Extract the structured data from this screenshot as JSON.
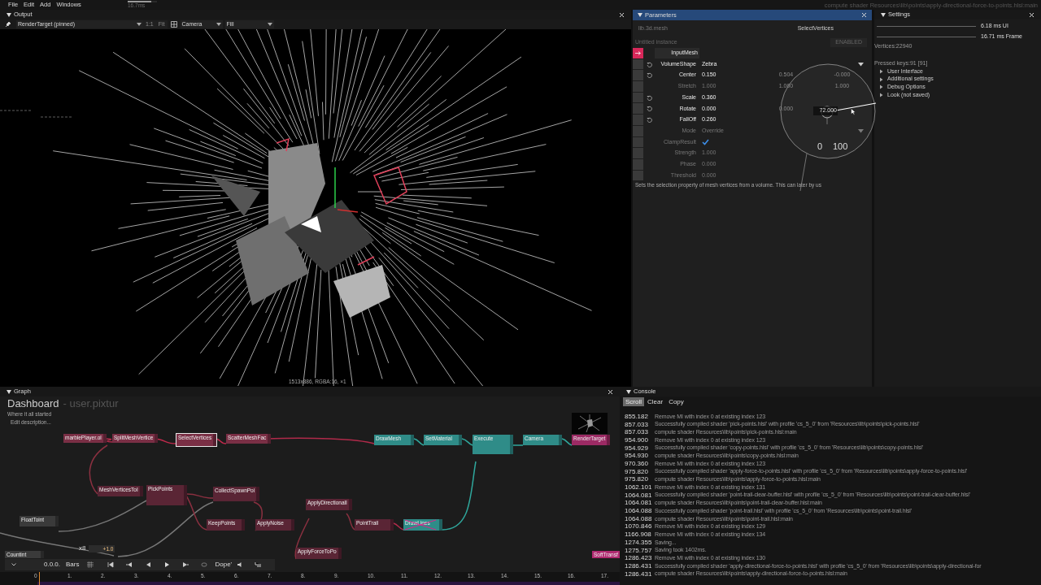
{
  "menu": [
    "File",
    "Edit",
    "Add",
    "Windows"
  ],
  "frame_meter": {
    "label": "16.7ms",
    "level": 0.8
  },
  "title_path": "compute shader Resources\\lib\\points\\apply-directional-force-to-points.hlsl:main",
  "output": {
    "title": "Output",
    "target": "RenderTarget (pinned)",
    "zoom_buttons": [
      "1:1",
      "Fit"
    ],
    "camera": "Camera",
    "fill": "Fill",
    "status": "1513x886, RGBA:16, ×1"
  },
  "parameters": {
    "title": "Parameters",
    "library": "lib.3d.mesh",
    "operator": "SelectVertices",
    "instance": "Untitled instance",
    "enabled_label": "ENABLED",
    "rows": [
      {
        "label": "InputMesh",
        "kind": "input",
        "modified": false
      },
      {
        "label": "VolumeShape",
        "kind": "dropdown",
        "value": "Zebra",
        "modified": true
      },
      {
        "label": "Center",
        "kind": "vector",
        "values": [
          "0.150",
          "0.504",
          "-0.000"
        ],
        "modified": true
      },
      {
        "label": "Stretch",
        "kind": "vector",
        "values": [
          "1.000",
          "1.000",
          "1.000"
        ],
        "modified": false
      },
      {
        "label": "Scale",
        "kind": "vector",
        "values": [
          "0.360"
        ],
        "modified": true
      },
      {
        "label": "Rotate",
        "kind": "vector",
        "values": [
          "0.000",
          "0.000"
        ],
        "modified": true
      },
      {
        "label": "FallOff",
        "kind": "vector",
        "values": [
          "0.260"
        ],
        "modified": true
      },
      {
        "label": "Mode",
        "kind": "dropdown",
        "value": "Override",
        "modified": false
      },
      {
        "label": "ClampResult",
        "kind": "checkbox",
        "checked": true,
        "modified": false
      },
      {
        "label": "Strength",
        "kind": "vector",
        "values": [
          "1.000"
        ],
        "modified": false
      },
      {
        "label": "Phase",
        "kind": "vector",
        "values": [
          "0.000"
        ],
        "modified": false
      },
      {
        "label": "Threshold",
        "kind": "vector",
        "values": [
          "0.000"
        ],
        "modified": false
      }
    ],
    "description": "Sets the selection property of mesh vertices from a volume. This can later by us",
    "dial": {
      "value": "72.000",
      "min": "0",
      "max": "100"
    }
  },
  "settings": {
    "title": "Settings",
    "meters": [
      "6.18 ms UI",
      "16.71 ms Frame"
    ],
    "vertices": "Vertices:22940",
    "pressed_keys": "Pressed keys:91 [91]",
    "items": [
      {
        "label": "User Interface",
        "expanded": false
      },
      {
        "label": "Additional settings",
        "expanded": false
      },
      {
        "label": "Debug Options",
        "expanded": false
      },
      {
        "label": "Look (not saved)",
        "expanded": false
      }
    ]
  },
  "graph": {
    "title": "Graph",
    "name": "Dashboard",
    "user": "- user.pixtur",
    "description": "Where it all started",
    "edit_link": "Edit description...",
    "nodes": [
      {
        "label": "marblePlayer.ol",
        "color": "#7a2f45",
        "selected": false,
        "bypassed": false
      },
      {
        "label": "SplitMeshVertice",
        "color": "#7a2f45",
        "selected": false,
        "bypassed": false
      },
      {
        "label": "SelectVertices",
        "color": "#7a2f45",
        "selected": true,
        "bypassed": false
      },
      {
        "label": "ScatterMeshFac",
        "color": "#7a2f45",
        "selected": false,
        "bypassed": false
      },
      {
        "label": "DrawMesh",
        "color": "#2f8c88",
        "selected": false,
        "bypassed": false
      },
      {
        "label": "SetMaterial",
        "color": "#2f8c88",
        "selected": false,
        "bypassed": false
      },
      {
        "label": "Execute",
        "color": "#2f8c88",
        "selected": false,
        "bypassed": false
      },
      {
        "label": "Camera",
        "color": "#2f8c88",
        "selected": false,
        "bypassed": false
      },
      {
        "label": "RenderTarget",
        "color": "#9c2a64",
        "selected": false,
        "bypassed": false
      },
      {
        "label": "MeshVerticesToI",
        "color": "#5a2535",
        "selected": false,
        "bypassed": false
      },
      {
        "label": "PickPoints",
        "color": "#5a2535",
        "selected": false,
        "bypassed": false
      },
      {
        "label": "CollectSpawnPoi",
        "color": "#5a2535",
        "selected": false,
        "bypassed": false
      },
      {
        "label": "KeepPoints",
        "color": "#5a2535",
        "selected": false,
        "bypassed": false
      },
      {
        "label": "ApplyNoise",
        "color": "#5a2535",
        "selected": false,
        "bypassed": false
      },
      {
        "label": "ApplyDirectionalI",
        "color": "#5a2535",
        "selected": false,
        "bypassed": false
      },
      {
        "label": "PointTrail",
        "color": "#5a2535",
        "selected": false,
        "bypassed": false
      },
      {
        "label": "DrawLines",
        "color": "#2f8c88",
        "selected": false,
        "bypassed": true
      },
      {
        "label": "ApplyForceToPo",
        "color": "#5a2535",
        "selected": false,
        "bypassed": false
      },
      {
        "label": "FloatToint",
        "color": "#3a3a3a",
        "selected": false,
        "bypassed": false
      },
      {
        "label": "Countint",
        "color": "#3a3a3a",
        "selected": false,
        "bypassed": false
      },
      {
        "label": "SoftTransf",
        "color": "#b02a70",
        "selected": false,
        "bypassed": false
      }
    ],
    "counter": {
      "label": "x8",
      "value": "+1.0"
    },
    "transport": {
      "time": "0.0.0.",
      "unit": "Bars",
      "mode": "Dope'"
    },
    "timeline_ticks": [
      "0",
      "1.",
      "2.",
      "3.",
      "4.",
      "5.",
      "6.",
      "7.",
      "8.",
      "9.",
      "10.",
      "11.",
      "12.",
      "13.",
      "14.",
      "15.",
      "16.",
      "17."
    ]
  },
  "console": {
    "title": "Console",
    "buttons": [
      {
        "label": "Scroll",
        "selected": true
      },
      {
        "label": "Clear",
        "selected": false
      },
      {
        "label": "Copy",
        "selected": false
      }
    ],
    "lines": [
      {
        "time": "855.182",
        "message": "Remove  MI with index 0 at existing index 123"
      },
      {
        "time": "857.033",
        "message": "Successfully compiled shader 'pick-points.hlsl' with profile 'cs_5_0' from 'Resources\\lib\\points\\pick-points.hlsl'"
      },
      {
        "time": "857.033",
        "message": "compute shader Resources\\lib\\points\\pick-points.hlsl:main"
      },
      {
        "time": "954.900",
        "message": "Remove  MI with index 0 at existing index 123"
      },
      {
        "time": "954.929",
        "message": "Successfully compiled shader 'copy-points.hlsl' with profile 'cs_5_0' from 'Resources\\lib\\points\\copy-points.hlsl'"
      },
      {
        "time": "954.930",
        "message": "compute shader Resources\\lib\\points\\copy-points.hlsl:main"
      },
      {
        "time": "970.360",
        "message": "Remove  MI with index 0 at existing index 123"
      },
      {
        "time": "975.820",
        "message": "Successfully compiled shader 'apply-force-to-points.hlsl' with profile 'cs_5_0' from 'Resources\\lib\\points\\apply-force-to-points.hlsl'"
      },
      {
        "time": "975.820",
        "message": "compute shader Resources\\lib\\points\\apply-force-to-points.hlsl:main"
      },
      {
        "time": "1062.101",
        "message": "Remove  MI with index 0 at existing index 131"
      },
      {
        "time": "1064.081",
        "message": "Successfully compiled shader 'point-trail-clear-buffer.hlsl' with profile 'cs_5_0' from 'Resources\\lib\\points\\point-trail-clear-buffer.hlsl'"
      },
      {
        "time": "1064.081",
        "message": "compute shader Resources\\lib\\points\\point-trail-clear-buffer.hlsl:main"
      },
      {
        "time": "1064.088",
        "message": "Successfully compiled shader 'point-trail.hlsl' with profile 'cs_5_0' from 'Resources\\lib\\points\\point-trail.hlsl'"
      },
      {
        "time": "1064.088",
        "message": "compute shader Resources\\lib\\points\\point-trail.hlsl:main"
      },
      {
        "time": "1070.846",
        "message": "Remove  MI with index 0 at existing index 129"
      },
      {
        "time": "1166.908",
        "message": "Remove  MI with index 0 at existing index 134"
      },
      {
        "time": "1274.355",
        "message": "Saving..."
      },
      {
        "time": "1275.757",
        "message": "Saving took 1402ms."
      },
      {
        "time": "1286.423",
        "message": "Remove  MI with index 0 at existing index 130"
      },
      {
        "time": "1286.431",
        "message": "Successfully compiled shader 'apply-directional-force-to-points.hlsl'  with profile 'cs_5_0' from 'Resources\\lib\\points\\apply-directional-for"
      },
      {
        "time": "1286.431",
        "message": "compute shader Resources\\lib\\points\\apply-directional-force-to-points.hlsl:main"
      }
    ]
  }
}
